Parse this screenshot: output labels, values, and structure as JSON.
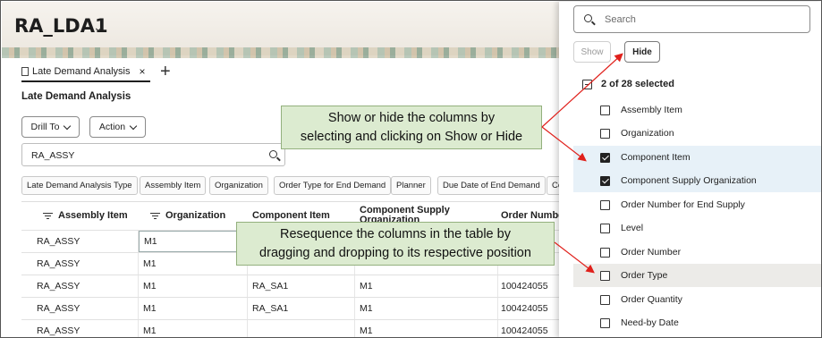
{
  "app": {
    "title": "RA_LDA1"
  },
  "tabs": [
    {
      "label": "Late Demand Analysis"
    }
  ],
  "section": {
    "title": "Late Demand Analysis"
  },
  "toolbar": {
    "drill_to": "Drill To",
    "action": "Action"
  },
  "search": {
    "value": "RA_ASSY"
  },
  "chips": [
    "Late Demand Analysis Type",
    "Assembly Item",
    "Organization",
    "Order Type for End Demand",
    "Planner",
    "Due Date of End Demand",
    "Co"
  ],
  "table": {
    "headers": [
      "Assembly Item",
      "Organization",
      "Component Item",
      "Component Supply Organization",
      "Order Numbe"
    ],
    "rows": [
      [
        "RA_ASSY",
        "M1",
        "",
        "",
        ""
      ],
      [
        "RA_ASSY",
        "M1",
        "",
        "",
        ""
      ],
      [
        "RA_ASSY",
        "M1",
        "RA_SA1",
        "M1",
        "100424055"
      ],
      [
        "RA_ASSY",
        "M1",
        "RA_SA1",
        "M1",
        "100424055"
      ],
      [
        "RA_ASSY",
        "M1",
        "",
        "M1",
        "100424055"
      ]
    ]
  },
  "panel": {
    "search_placeholder": "Search",
    "show_label": "Show",
    "hide_label": "Hide",
    "summary": "2 of 28 selected",
    "columns": [
      {
        "label": "Assembly Item",
        "checked": false
      },
      {
        "label": "Organization",
        "checked": false
      },
      {
        "label": "Component Item",
        "checked": true
      },
      {
        "label": "Component Supply Organization",
        "checked": true
      },
      {
        "label": "Order Number for End Supply",
        "checked": false
      },
      {
        "label": "Level",
        "checked": false
      },
      {
        "label": "Order Number",
        "checked": false
      },
      {
        "label": "Order Type",
        "checked": false
      },
      {
        "label": "Order Quantity",
        "checked": false
      },
      {
        "label": "Need-by Date",
        "checked": false
      }
    ]
  },
  "callouts": {
    "show_hide_line1": "Show or hide the columns by",
    "show_hide_line2": "selecting and clicking on Show or Hide",
    "resequence_line1": "Resequence the columns in the table by",
    "resequence_line2": "dragging and dropping to its respective position"
  },
  "colors": {
    "callout_bg": "#dcebd0",
    "arrow": "#e0201b",
    "selected_row": "#e7f1f8"
  }
}
